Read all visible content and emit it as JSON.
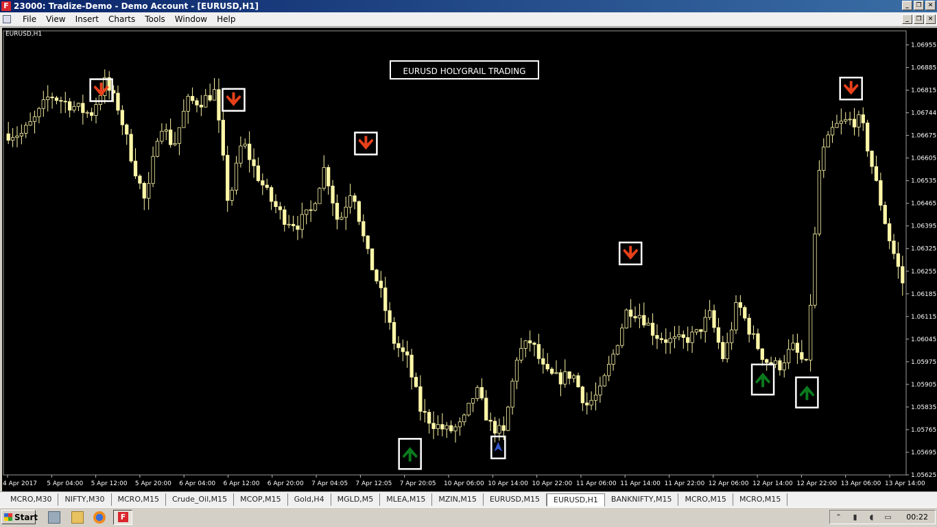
{
  "window": {
    "title": "23000: Tradize-Demo - Demo Account - [EURUSD,H1]",
    "app_icon_letter": "F",
    "controls": [
      "_",
      "❐",
      "✕"
    ]
  },
  "menu": {
    "items": [
      "File",
      "View",
      "Insert",
      "Charts",
      "Tools",
      "Window",
      "Help"
    ],
    "controls": [
      "_",
      "❐",
      "✕"
    ]
  },
  "chart": {
    "symbol_label": "EURUSD,H1",
    "banner_text": "EURUSD HOLYGRAIL TRADING",
    "colors": {
      "background": "#000000",
      "candle": "#fff7a8",
      "sell_arrow": "#e8401a",
      "buy_arrow": "#0b7a1e",
      "small_buy_arrow": "#3355cc",
      "marker_frame": "#ffffff"
    }
  },
  "chart_data": {
    "type": "candlestick",
    "y_ticks": [
      "1.06955",
      "1.06885",
      "1.06815",
      "1.06744",
      "1.06675",
      "1.06605",
      "1.06535",
      "1.06465",
      "1.06395",
      "1.06325",
      "1.06255",
      "1.06185",
      "1.06115",
      "1.06045",
      "1.05975",
      "1.05905",
      "1.05835",
      "1.05765",
      "1.05695",
      "1.05625"
    ],
    "ylim": [
      1.05625,
      1.06955
    ],
    "x_ticks": [
      "4 Apr 2017",
      "5 Apr 04:00",
      "5 Apr 12:00",
      "5 Apr 20:00",
      "6 Apr 04:00",
      "6 Apr 12:00",
      "6 Apr 20:00",
      "7 Apr 04:05",
      "7 Apr 12:05",
      "7 Apr 20:05",
      "10 Apr 06:00",
      "10 Apr 14:00",
      "10 Apr 22:00",
      "11 Apr 06:00",
      "11 Apr 14:00",
      "11 Apr 22:00",
      "12 Apr 06:00",
      "12 Apr 14:00",
      "12 Apr 22:00",
      "13 Apr 06:00",
      "13 Apr 14:00"
    ],
    "close_path": [
      1.0668,
      1.0668,
      1.0673,
      1.068,
      1.0678,
      1.0676,
      1.0674,
      1.0684,
      1.0676,
      1.066,
      1.0646,
      1.0672,
      1.0664,
      1.0678,
      1.0678,
      1.0681,
      1.0646,
      1.0666,
      1.0656,
      1.0648,
      1.0642,
      1.064,
      1.0644,
      1.0658,
      1.064,
      1.0652,
      1.0632,
      1.062,
      1.0604,
      1.0598,
      1.0582,
      1.0578,
      1.0576,
      1.0578,
      1.0589,
      1.0578,
      1.0575,
      1.06,
      1.0604,
      1.0594,
      1.0592,
      1.0594,
      1.0584,
      1.0588,
      1.06,
      1.0614,
      1.0612,
      1.0606,
      1.0604,
      1.0604,
      1.0606,
      1.0612,
      1.0598,
      1.0616,
      1.0606,
      1.0598,
      1.0596,
      1.0602,
      1.0596,
      1.066,
      1.067,
      1.0672,
      1.0672,
      1.0654,
      1.0636,
      1.0622
    ],
    "signals": [
      {
        "type": "sell",
        "x_tick": "5 Apr 12:00",
        "price": 1.06815
      },
      {
        "type": "sell",
        "x_tick": "6 Apr 12:00",
        "price": 1.06785
      },
      {
        "type": "sell",
        "x_tick": "7 Apr 12:05",
        "price": 1.0665
      },
      {
        "type": "buy",
        "x_tick": "7 Apr 20:05",
        "price": 1.0569
      },
      {
        "type": "buy-small",
        "x_tick": "10 Apr 14:00",
        "price": 1.0571
      },
      {
        "type": "sell",
        "x_tick": "11 Apr 14:00",
        "price": 1.0631
      },
      {
        "type": "buy",
        "x_tick": "12 Apr 14:00",
        "price": 1.0592
      },
      {
        "type": "buy",
        "x_tick": "12 Apr 22:00",
        "price": 1.0588
      },
      {
        "type": "sell",
        "x_tick": "13 Apr 06:00",
        "price": 1.0682
      }
    ]
  },
  "tabs": {
    "items": [
      "MCRO,M30",
      "NIFTY,M30",
      "MCRO,M15",
      "Crude_Oil,M15",
      "MCOP,M15",
      "Gold,H4",
      "MGLD,M5",
      "MLEA,M15",
      "MZIN,M15",
      "EURUSD,M15",
      "EURUSD,H1",
      "BANKNIFTY,M15",
      "MCRO,M15",
      "MCRO,M15"
    ],
    "active_index": 10
  },
  "taskbar": {
    "start_label": "Start",
    "clock": "00:22"
  }
}
